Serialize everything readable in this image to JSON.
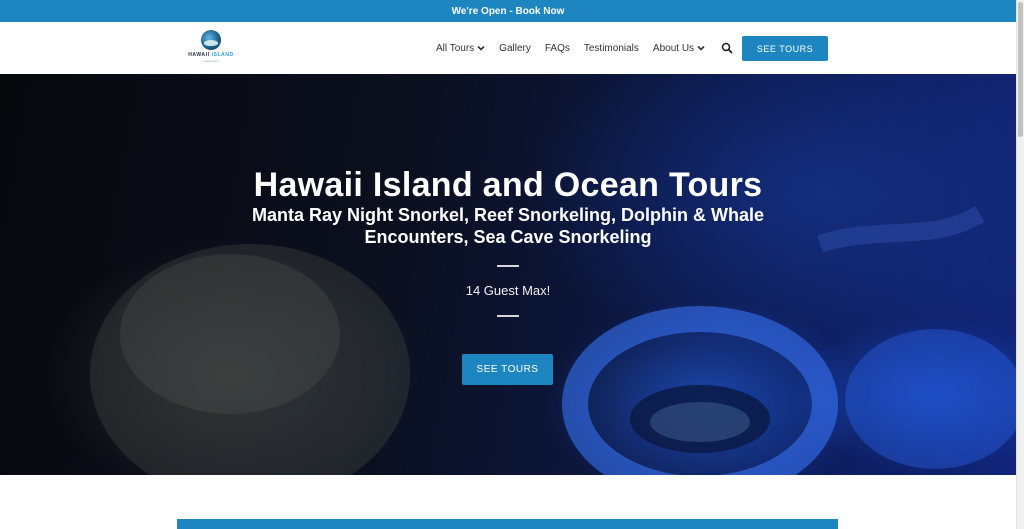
{
  "announcement": {
    "text": "We're Open - Book Now"
  },
  "logo": {
    "line1": "HAWAII",
    "line2": "ISLAND",
    "sub": "ocean tours"
  },
  "nav": {
    "items": [
      {
        "label": "All Tours",
        "has_dropdown": true
      },
      {
        "label": "Gallery",
        "has_dropdown": false
      },
      {
        "label": "FAQs",
        "has_dropdown": false
      },
      {
        "label": "Testimonials",
        "has_dropdown": false
      },
      {
        "label": "About Us",
        "has_dropdown": true
      }
    ],
    "search_icon": "search-icon",
    "cta_label": "SEE TOURS"
  },
  "hero": {
    "title": "Hawaii Island and Ocean Tours",
    "subtitle": "Manta Ray Night Snorkel, Reef Snorkeling, Dolphin & Whale Encounters, Sea Cave Snorkeling",
    "tagline": "14 Guest Max!",
    "cta_label": "SEE TOURS"
  },
  "colors": {
    "brand": "#1d86c0",
    "nav_text": "#333333",
    "hero_text": "#ffffff"
  }
}
